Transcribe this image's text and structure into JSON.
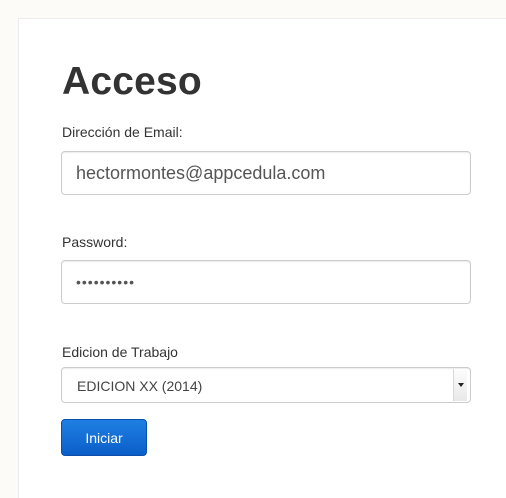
{
  "form": {
    "title": "Acceso",
    "email_label": "Dirección de Email:",
    "email_value": "hectormontes@appcedula.com",
    "password_label": "Password:",
    "password_value": "••••••••••",
    "edition_label": "Edicion de Trabajo",
    "edition_selected": "EDICION XX (2014)",
    "submit_label": "Iniciar"
  },
  "colors": {
    "button": "#0b66d0",
    "background": "#fcfbf8"
  }
}
